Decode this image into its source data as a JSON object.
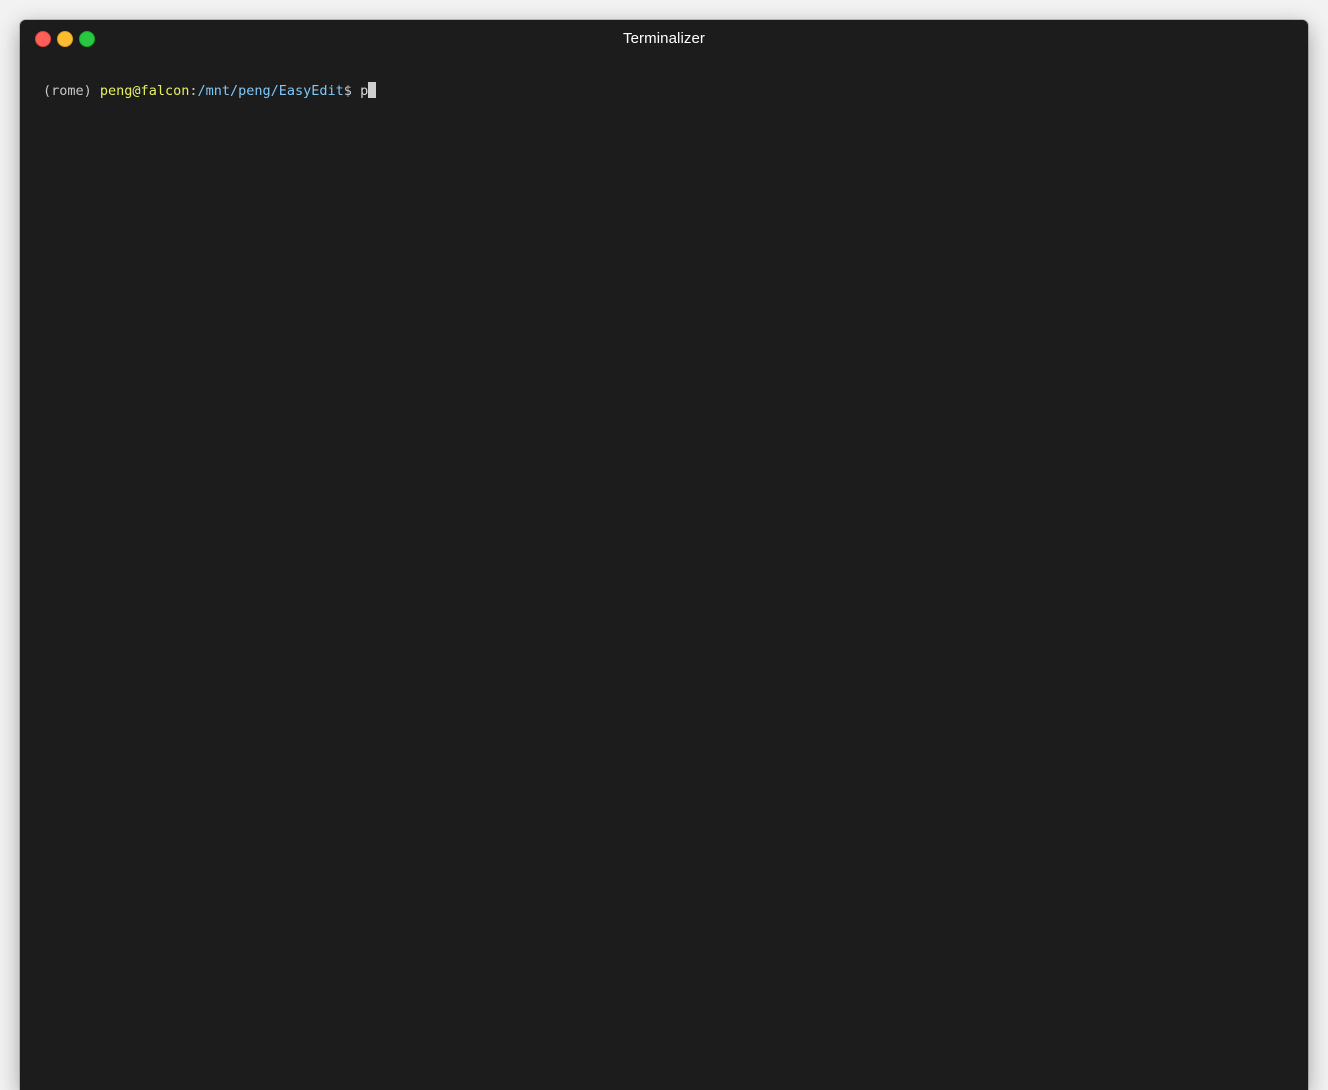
{
  "window": {
    "title": "Terminalizer"
  },
  "terminal": {
    "prompt": {
      "env": "(rome)",
      "userhost": "peng@falcon",
      "separator": ":",
      "path": "/mnt/peng/EasyEdit",
      "symbol": "$"
    },
    "input": "p"
  },
  "colors": {
    "background": "#1c1c1c",
    "userhost": "#e8f060",
    "path": "#7ec8f8",
    "close": "#ff5f57",
    "minimize": "#febc2e",
    "maximize": "#28c840"
  }
}
